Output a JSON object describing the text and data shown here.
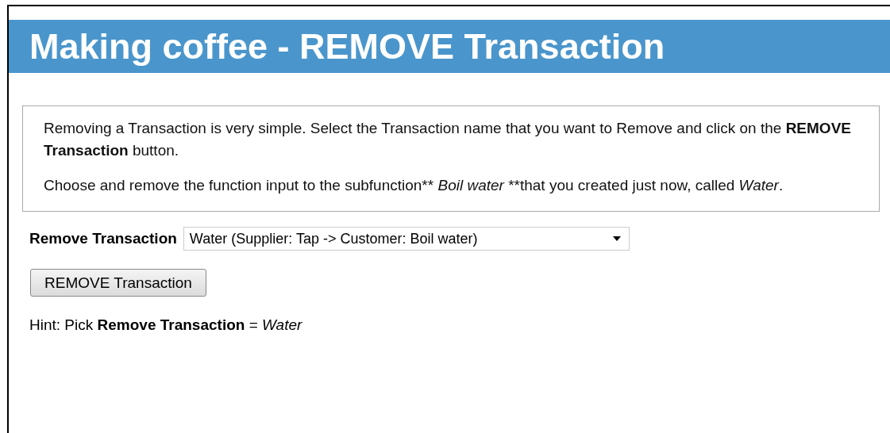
{
  "header": {
    "title": "Making coffee - REMOVE Transaction"
  },
  "instructions": [
    "Removing a Transaction is very simple. Select the Transaction name that you want to Remove and click on the **REMOVE Transaction** button.",
    "Choose and remove the function input to the subfunction** *Boil water* **that you created just now, called *Water*."
  ],
  "select": {
    "label": "Remove Transaction",
    "value": "Water (Supplier: Tap -> Customer: Boil water)"
  },
  "button": "REMOVE Transaction",
  "hint": "Hint: Pick **Remove Transaction** = *Water*"
}
